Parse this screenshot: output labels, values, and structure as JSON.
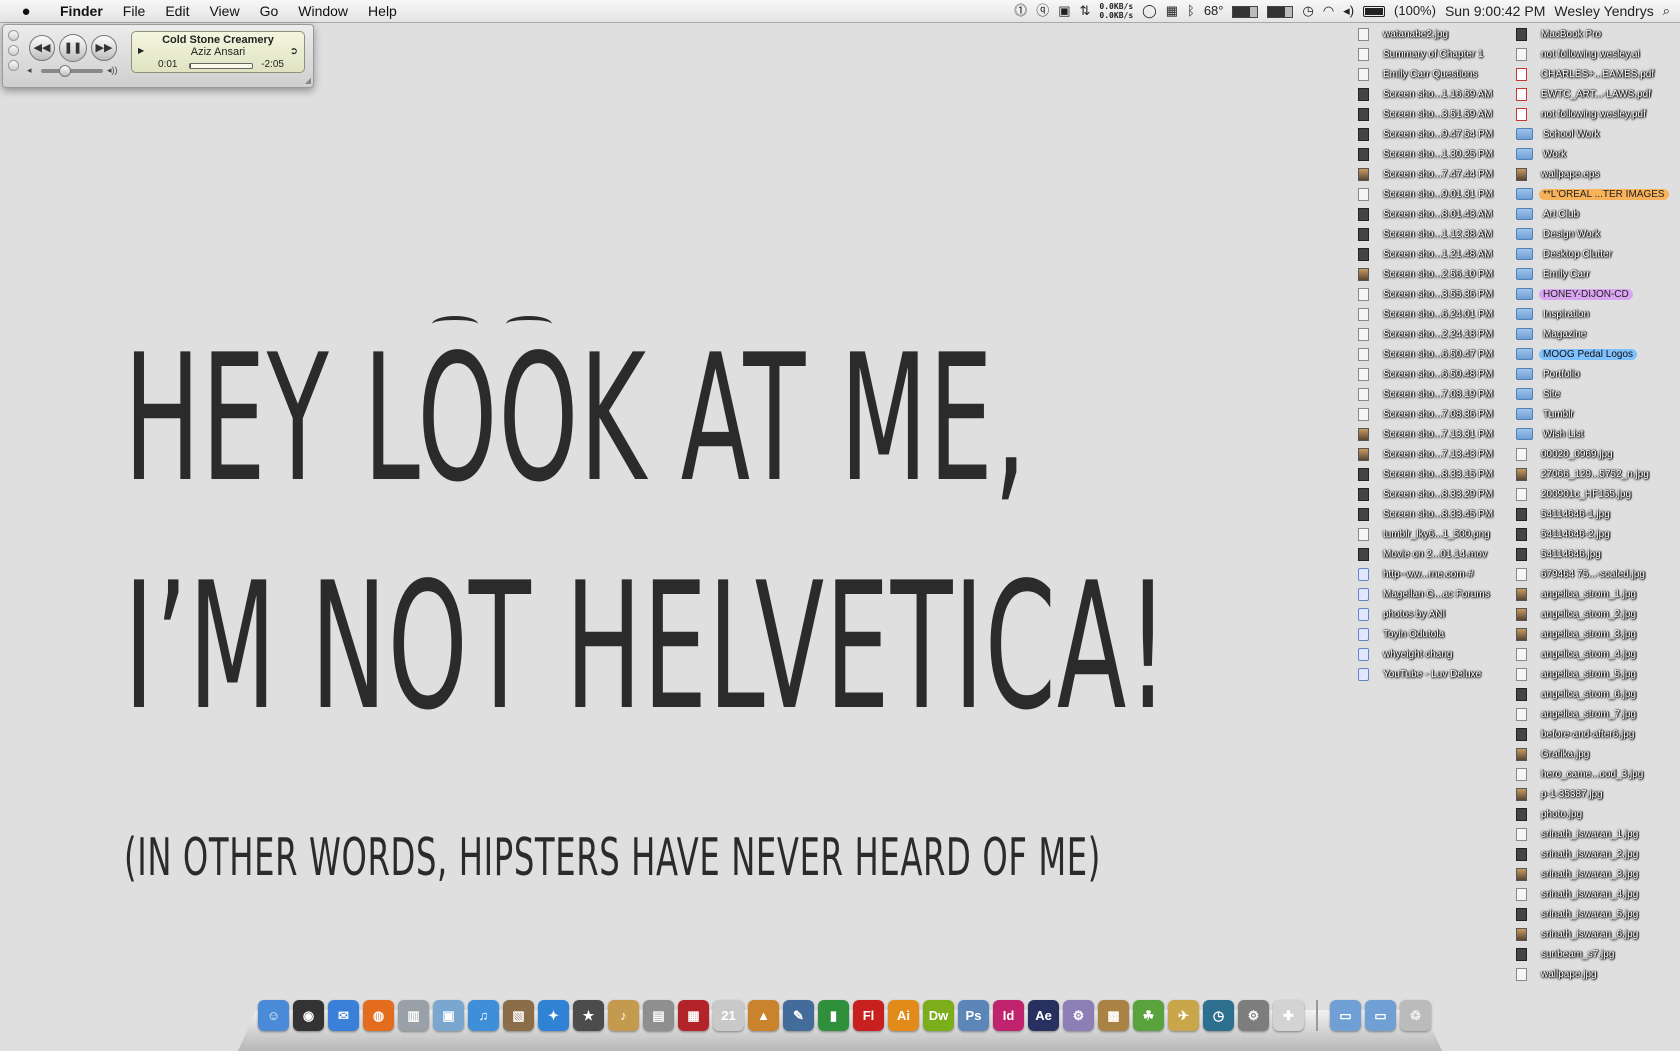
{
  "menubar": {
    "apple_icon": "apple-logo",
    "app_name": "Finder",
    "menus": [
      "File",
      "Edit",
      "View",
      "Go",
      "Window",
      "Help"
    ],
    "status": {
      "net_up": "0.0KB/s",
      "net_down": "0.0KB/s",
      "temperature": "68°",
      "battery_pct": "(100%)",
      "clock": "Sun 9:00:42 PM",
      "user": "Wesley Yendrys"
    }
  },
  "itunes": {
    "song": "Cold Stone Creamery",
    "artist": "Aziz Ansari",
    "elapsed": "0:01",
    "remaining": "-2:05",
    "progress": 0.01,
    "volume": 0.35
  },
  "wallpaper": {
    "line1": "HEY LOOK AT ME,",
    "line2": "I’M NOT HELVETICA!",
    "line3": "(IN OTHER WORDS, HIPSTERS HAVE NEVER HEARD OF ME)"
  },
  "desktop": {
    "col1": [
      {
        "name": "watanabe2.jpg",
        "icon": "file"
      },
      {
        "name": "Summary of Chapter 1",
        "icon": "file"
      },
      {
        "name": "Emily Carr Questions",
        "icon": "file"
      },
      {
        "name": "Screen sho...1.16.59 AM",
        "icon": "dark"
      },
      {
        "name": "Screen sho...3.51.59 AM",
        "icon": "dark"
      },
      {
        "name": "Screen sho...9.47.54 PM",
        "icon": "dark"
      },
      {
        "name": "Screen sho...1.30.25 PM",
        "icon": "dark"
      },
      {
        "name": "Screen sho...7.47.44 PM",
        "icon": "img"
      },
      {
        "name": "Screen sho...9.01.31 PM",
        "icon": "file"
      },
      {
        "name": "Screen sho...8.01.43 AM",
        "icon": "dark"
      },
      {
        "name": "Screen sho...1.12.38 AM",
        "icon": "dark"
      },
      {
        "name": "Screen sho...1.21.48 AM",
        "icon": "dark"
      },
      {
        "name": "Screen sho...2.56.10 PM",
        "icon": "img"
      },
      {
        "name": "Screen sho...3.55.36 PM",
        "icon": "file"
      },
      {
        "name": "Screen sho...6.24.01 PM",
        "icon": "file"
      },
      {
        "name": "Screen sho...2.24.18 PM",
        "icon": "file"
      },
      {
        "name": "Screen sho...6.50.47 PM",
        "icon": "file"
      },
      {
        "name": "Screen sho...6.50.48 PM",
        "icon": "file"
      },
      {
        "name": "Screen sho...7.08.19 PM",
        "icon": "file"
      },
      {
        "name": "Screen sho...7.08.36 PM",
        "icon": "file"
      },
      {
        "name": "Screen sho...7.13.31 PM",
        "icon": "img"
      },
      {
        "name": "Screen sho...7.13.43 PM",
        "icon": "img"
      },
      {
        "name": "Screen sho...8.33.15 PM",
        "icon": "dark"
      },
      {
        "name": "Screen sho...8.33.29 PM",
        "icon": "dark"
      },
      {
        "name": "Screen sho...8.33.45 PM",
        "icon": "dark"
      },
      {
        "name": "tumblr_lky6...1_500.png",
        "icon": "file"
      },
      {
        "name": "Movie on 2...01.14.mov",
        "icon": "dark"
      },
      {
        "name": "http--ww...rne.com-#",
        "icon": "web"
      },
      {
        "name": "Magellan G...ac Forums",
        "icon": "web"
      },
      {
        "name": "photos by ANI",
        "icon": "web"
      },
      {
        "name": "Toyin Odutola",
        "icon": "web"
      },
      {
        "name": "whyeight chang",
        "icon": "web"
      },
      {
        "name": "YouTube - Luv Deluxe",
        "icon": "web"
      }
    ],
    "col2": [
      {
        "name": "MacBook Pro",
        "icon": "dark",
        "tag": ""
      },
      {
        "name": "not following wesley.ai",
        "icon": "file",
        "tag": ""
      },
      {
        "name": "CHARLES+...EAMES.pdf",
        "icon": "pdf",
        "tag": ""
      },
      {
        "name": "EWTC_ART...-LAWS.pdf",
        "icon": "pdf",
        "tag": ""
      },
      {
        "name": "not following wesley.pdf",
        "icon": "pdf",
        "tag": ""
      },
      {
        "name": "School Work",
        "icon": "folder",
        "tag": ""
      },
      {
        "name": "Work",
        "icon": "folder",
        "tag": ""
      },
      {
        "name": "wallpape.eps",
        "icon": "img",
        "tag": ""
      },
      {
        "name": "**L'OREAL ...TER IMAGES",
        "icon": "folder",
        "tag": "orange"
      },
      {
        "name": "Art Club",
        "icon": "folder",
        "tag": ""
      },
      {
        "name": "Design Work",
        "icon": "folder",
        "tag": ""
      },
      {
        "name": "Desktop Clutter",
        "icon": "folder",
        "tag": ""
      },
      {
        "name": "Emily Carr",
        "icon": "folder",
        "tag": ""
      },
      {
        "name": "HONEY-DIJON-CD",
        "icon": "folder",
        "tag": "purple"
      },
      {
        "name": "Inspiration",
        "icon": "folder",
        "tag": ""
      },
      {
        "name": "Magazine",
        "icon": "folder",
        "tag": ""
      },
      {
        "name": "MOOG Pedal Logos",
        "icon": "folder",
        "tag": "blue"
      },
      {
        "name": "Portfolio",
        "icon": "folder",
        "tag": ""
      },
      {
        "name": "Site",
        "icon": "folder",
        "tag": ""
      },
      {
        "name": "Tumblr",
        "icon": "folder",
        "tag": ""
      },
      {
        "name": "Wish List",
        "icon": "folder",
        "tag": ""
      },
      {
        "name": "00020_0969.jpg",
        "icon": "file",
        "tag": ""
      },
      {
        "name": "27066_129...5752_n.jpg",
        "icon": "img",
        "tag": ""
      },
      {
        "name": "200901c_HF155.jpg",
        "icon": "file",
        "tag": ""
      },
      {
        "name": "54114646-1.jpg",
        "icon": "dark",
        "tag": ""
      },
      {
        "name": "54114646-2.jpg",
        "icon": "dark",
        "tag": ""
      },
      {
        "name": "54114646.jpg",
        "icon": "dark",
        "tag": ""
      },
      {
        "name": "679464 75...-scaled.jpg",
        "icon": "file",
        "tag": ""
      },
      {
        "name": "angelica_strom_1.jpg",
        "icon": "img",
        "tag": ""
      },
      {
        "name": "angelica_strom_2.jpg",
        "icon": "img",
        "tag": ""
      },
      {
        "name": "angelica_strom_3.jpg",
        "icon": "img",
        "tag": ""
      },
      {
        "name": "angelica_strom_4.jpg",
        "icon": "file",
        "tag": ""
      },
      {
        "name": "angelica_strom_5.jpg",
        "icon": "file",
        "tag": ""
      },
      {
        "name": "angelica_strom_6.jpg",
        "icon": "dark",
        "tag": ""
      },
      {
        "name": "angelica_strom_7.jpg",
        "icon": "file",
        "tag": ""
      },
      {
        "name": "before-and-after6.jpg",
        "icon": "dark",
        "tag": ""
      },
      {
        "name": "Grafika.jpg",
        "icon": "img",
        "tag": ""
      },
      {
        "name": "hero_came...ood_3.jpg",
        "icon": "file",
        "tag": ""
      },
      {
        "name": "p-1-35387.jpg",
        "icon": "img",
        "tag": ""
      },
      {
        "name": "photo.jpg",
        "icon": "dark",
        "tag": ""
      },
      {
        "name": "srinath_iswaran_1.jpg",
        "icon": "file",
        "tag": ""
      },
      {
        "name": "srinath_iswaran_2.jpg",
        "icon": "dark",
        "tag": ""
      },
      {
        "name": "srinath_iswaran_3.jpg",
        "icon": "img",
        "tag": ""
      },
      {
        "name": "srinath_iswaran_4.jpg",
        "icon": "file",
        "tag": ""
      },
      {
        "name": "srinath_iswaran_5.jpg",
        "icon": "dark",
        "tag": ""
      },
      {
        "name": "srinath_iswaran_6.jpg",
        "icon": "img",
        "tag": ""
      },
      {
        "name": "sunbeam_s7.jpg",
        "icon": "dark",
        "tag": ""
      },
      {
        "name": "wallpape.jpg",
        "icon": "file",
        "tag": ""
      }
    ]
  },
  "dock": [
    {
      "name": "finder",
      "glyph": "☺",
      "color": "#4b8ad6"
    },
    {
      "name": "dashboard",
      "glyph": "◉",
      "color": "#333333"
    },
    {
      "name": "ichat",
      "glyph": "✉",
      "color": "#3a7fd8"
    },
    {
      "name": "firefox",
      "glyph": "◍",
      "color": "#e46c1f"
    },
    {
      "name": "mac-pro",
      "glyph": "▥",
      "color": "#9aa0a8"
    },
    {
      "name": "preview",
      "glyph": "▣",
      "color": "#7aa7cf"
    },
    {
      "name": "itunes",
      "glyph": "♫",
      "color": "#3e8ed9"
    },
    {
      "name": "iphoto",
      "glyph": "▧",
      "color": "#8a6e4a"
    },
    {
      "name": "safari",
      "glyph": "✦",
      "color": "#2f82d4"
    },
    {
      "name": "imovie",
      "glyph": "★",
      "color": "#4c4c4c"
    },
    {
      "name": "garageband",
      "glyph": "♪",
      "color": "#c49a4e"
    },
    {
      "name": "iweb",
      "glyph": "▤",
      "color": "#8f8f8f"
    },
    {
      "name": "photo-booth",
      "glyph": "▦",
      "color": "#b3242a"
    },
    {
      "name": "ical",
      "glyph": "21",
      "color": "#c9c9c9"
    },
    {
      "name": "keynote",
      "glyph": "▲",
      "color": "#c8832c"
    },
    {
      "name": "pages",
      "glyph": "✎",
      "color": "#446c9b"
    },
    {
      "name": "numbers",
      "glyph": "▮",
      "color": "#2f8f3a"
    },
    {
      "name": "flash",
      "glyph": "Fl",
      "color": "#c8201f"
    },
    {
      "name": "illustrator",
      "glyph": "Ai",
      "color": "#e28b1a"
    },
    {
      "name": "dreamweaver",
      "glyph": "Dw",
      "color": "#7cae1b"
    },
    {
      "name": "photoshop",
      "glyph": "Ps",
      "color": "#5d86b8"
    },
    {
      "name": "indesign",
      "glyph": "Id",
      "color": "#c0246f"
    },
    {
      "name": "after-effects",
      "glyph": "Ae",
      "color": "#27305f"
    },
    {
      "name": "utilities",
      "glyph": "⚙",
      "color": "#8b7fb6"
    },
    {
      "name": "transmit",
      "glyph": "▩",
      "color": "#a98345"
    },
    {
      "name": "cyberduck",
      "glyph": "☘",
      "color": "#5aa23c"
    },
    {
      "name": "twitter-client",
      "glyph": "✈",
      "color": "#c9a64a"
    },
    {
      "name": "time-machine",
      "glyph": "◷",
      "color": "#2d6f8f"
    },
    {
      "name": "system-preferences",
      "glyph": "⚙",
      "color": "#7d7d7d"
    },
    {
      "name": "app-store",
      "glyph": "✚",
      "color": "#d3d3d3"
    },
    {
      "name": "separator",
      "glyph": "",
      "color": "#999999"
    },
    {
      "name": "documents-stack",
      "glyph": "▭",
      "color": "#6f9fd4"
    },
    {
      "name": "downloads-stack",
      "glyph": "▭",
      "color": "#6f9fd4"
    },
    {
      "name": "trash",
      "glyph": "♲",
      "color": "#bbbbbb"
    }
  ]
}
